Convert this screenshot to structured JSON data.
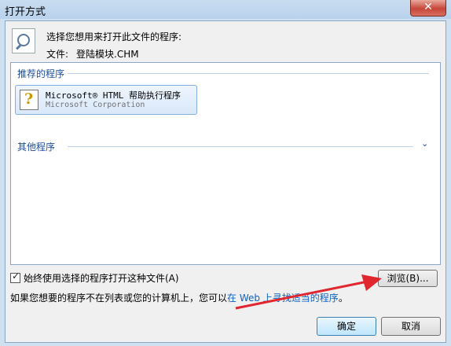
{
  "window": {
    "title": "打开方式",
    "close_label": "✕"
  },
  "header": {
    "prompt": "选择您想用来打开此文件的程序:",
    "file_label": "文件:",
    "file_name": "登陆模块.CHM"
  },
  "programs": {
    "recommended_header": "推荐的程序",
    "recommended": [
      {
        "name": "Microsoft® HTML 帮助执行程序",
        "company": "Microsoft Corporation",
        "icon": "help-file-icon"
      }
    ],
    "other_header": "其他程序",
    "expand_icon": "⌄"
  },
  "options": {
    "always_use_label": "始终使用选择的程序打开这种文件(A)",
    "always_use_checked": true
  },
  "buttons": {
    "browse": "浏览(B)...",
    "ok": "确定",
    "cancel": "取消"
  },
  "info": {
    "text_before": "如果您想要的程序不在列表或您的计算机上，您可以",
    "link": "在 Web 上寻找适当的程序",
    "text_after": "。"
  },
  "colors": {
    "link": "#0b62c4",
    "group_header": "#1e4f9a",
    "annotation_arrow": "#e0262e"
  }
}
